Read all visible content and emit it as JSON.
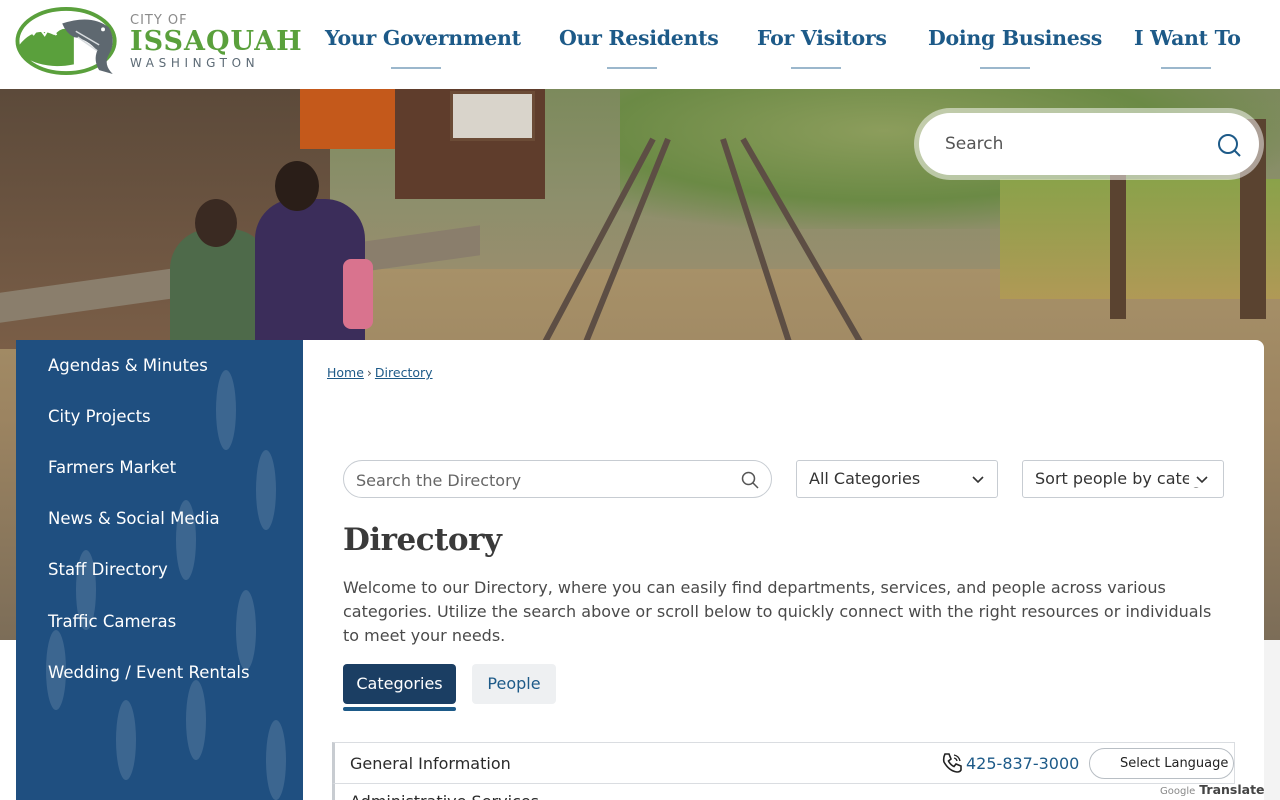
{
  "logo": {
    "city_of": "CITY OF",
    "name": "ISSAQUAH",
    "state": "WASHINGTON"
  },
  "nav": [
    {
      "label": "Your Government"
    },
    {
      "label": "Our Residents"
    },
    {
      "label": "For Visitors"
    },
    {
      "label": "Doing Business"
    },
    {
      "label": "I Want To"
    }
  ],
  "search": {
    "placeholder": "Search"
  },
  "sidebar": {
    "items": [
      {
        "label": "Agendas & Minutes"
      },
      {
        "label": "City Projects"
      },
      {
        "label": "Farmers Market"
      },
      {
        "label": "News & Social Media"
      },
      {
        "label": "Staff Directory"
      },
      {
        "label": "Traffic Cameras"
      },
      {
        "label": "Wedding / Event Rentals"
      }
    ]
  },
  "breadcrumb": {
    "home": "Home",
    "separator": "›",
    "current": "Directory"
  },
  "directory": {
    "search_placeholder": "Search the Directory",
    "category_select": "All Categories",
    "sort_select": "Sort people by categ",
    "title": "Directory",
    "description": "Welcome to our Directory, where you can easily find departments, services, and people across various categories. Utilize the search above or scroll below to quickly connect with the right resources or individuals to meet your needs.",
    "tabs": {
      "categories": "Categories",
      "people": "People"
    },
    "rows": [
      {
        "name": "General Information",
        "phone": "425-837-3000"
      },
      {
        "name": "Administrative Services",
        "phone": ""
      }
    ]
  },
  "translate": {
    "select_language": "Select Language",
    "google": "Google",
    "translate": "Translate"
  },
  "colors": {
    "nav_blue": "#1d5a88",
    "sidebar_blue": "#1f4f80",
    "logo_green": "#5aa03c",
    "tab_active": "#1b3e63"
  }
}
